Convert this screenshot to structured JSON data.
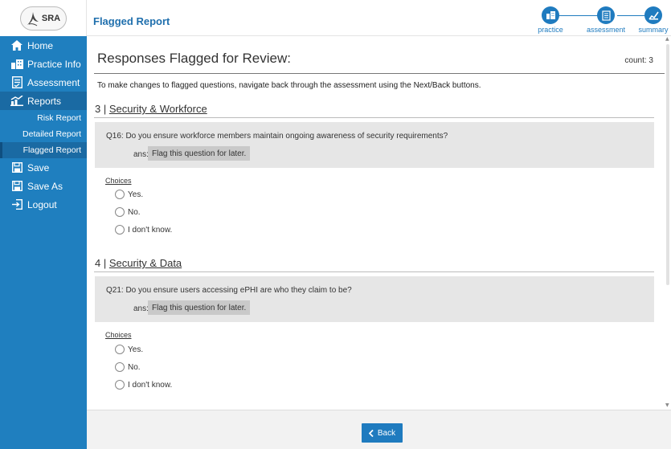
{
  "header": {
    "logo_text": "SRA",
    "title": "Flagged Report",
    "steps": [
      {
        "label": "practice",
        "icon": "building-icon"
      },
      {
        "label": "assessment",
        "icon": "checklist-icon"
      },
      {
        "label": "summary",
        "icon": "chart-icon"
      }
    ]
  },
  "sidebar": {
    "items": [
      {
        "label": "Home",
        "icon": "home-icon"
      },
      {
        "label": "Practice Info",
        "icon": "building-icon"
      },
      {
        "label": "Assessment",
        "icon": "checklist-icon"
      },
      {
        "label": "Reports",
        "icon": "chart-icon"
      },
      {
        "label": "Save",
        "icon": "save-icon"
      },
      {
        "label": "Save As",
        "icon": "save-icon"
      },
      {
        "label": "Logout",
        "icon": "logout-icon"
      }
    ],
    "subitems": [
      {
        "label": "Risk Report"
      },
      {
        "label": "Detailed Report"
      },
      {
        "label": "Flagged Report"
      }
    ]
  },
  "main": {
    "title": "Responses Flagged for Review:",
    "count": "count: 3",
    "instructions": "To make changes to flagged questions, navigate back through the assessment using the Next/Back buttons.",
    "sections": [
      {
        "number": "3 | ",
        "name": "Security & Workforce",
        "question": "Q16: Do you ensure workforce members maintain ongoing awareness of security requirements?",
        "ans_label": "ans:",
        "answer": "Flag this question for later.",
        "choices_label": "Choices",
        "choices": [
          "Yes.",
          "No.",
          "I don't know."
        ]
      },
      {
        "number": "4 | ",
        "name": "Security & Data",
        "question": "Q21: Do you ensure users accessing ePHI are who they claim to be?",
        "ans_label": "ans:",
        "answer": "Flag this question for later.",
        "choices_label": "Choices",
        "choices": [
          "Yes.",
          "No.",
          "I don't know."
        ]
      }
    ]
  },
  "footer": {
    "back_label": "Back"
  },
  "colors": {
    "accent": "#1f7bbf",
    "sidebar": "#1f7fbf",
    "title": "#1f6fad"
  }
}
